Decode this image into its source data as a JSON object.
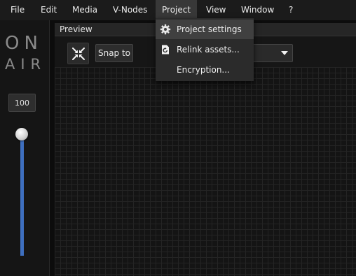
{
  "menubar": {
    "items": [
      {
        "label": "File"
      },
      {
        "label": "Edit"
      },
      {
        "label": "Media"
      },
      {
        "label": "V-Nodes"
      },
      {
        "label": "Project"
      },
      {
        "label": "View"
      },
      {
        "label": "Window"
      },
      {
        "label": "?"
      }
    ],
    "active_index": 4
  },
  "logo": {
    "line1": "ON",
    "line2": "AIR"
  },
  "volume": {
    "value": "100",
    "level": 1.0
  },
  "preview": {
    "title": "Preview",
    "snap_label": "Snap to"
  },
  "project_menu": {
    "items": [
      {
        "label": "Project settings",
        "icon": "gear-icon",
        "hovered": true
      },
      {
        "label": "Relink assets...",
        "icon": "relink-icon"
      },
      {
        "label": "Encryption..."
      }
    ]
  },
  "colors": {
    "accent": "#3e6fbf",
    "background": "#0c0c0c",
    "menu_bg": "#2b2b2b"
  }
}
